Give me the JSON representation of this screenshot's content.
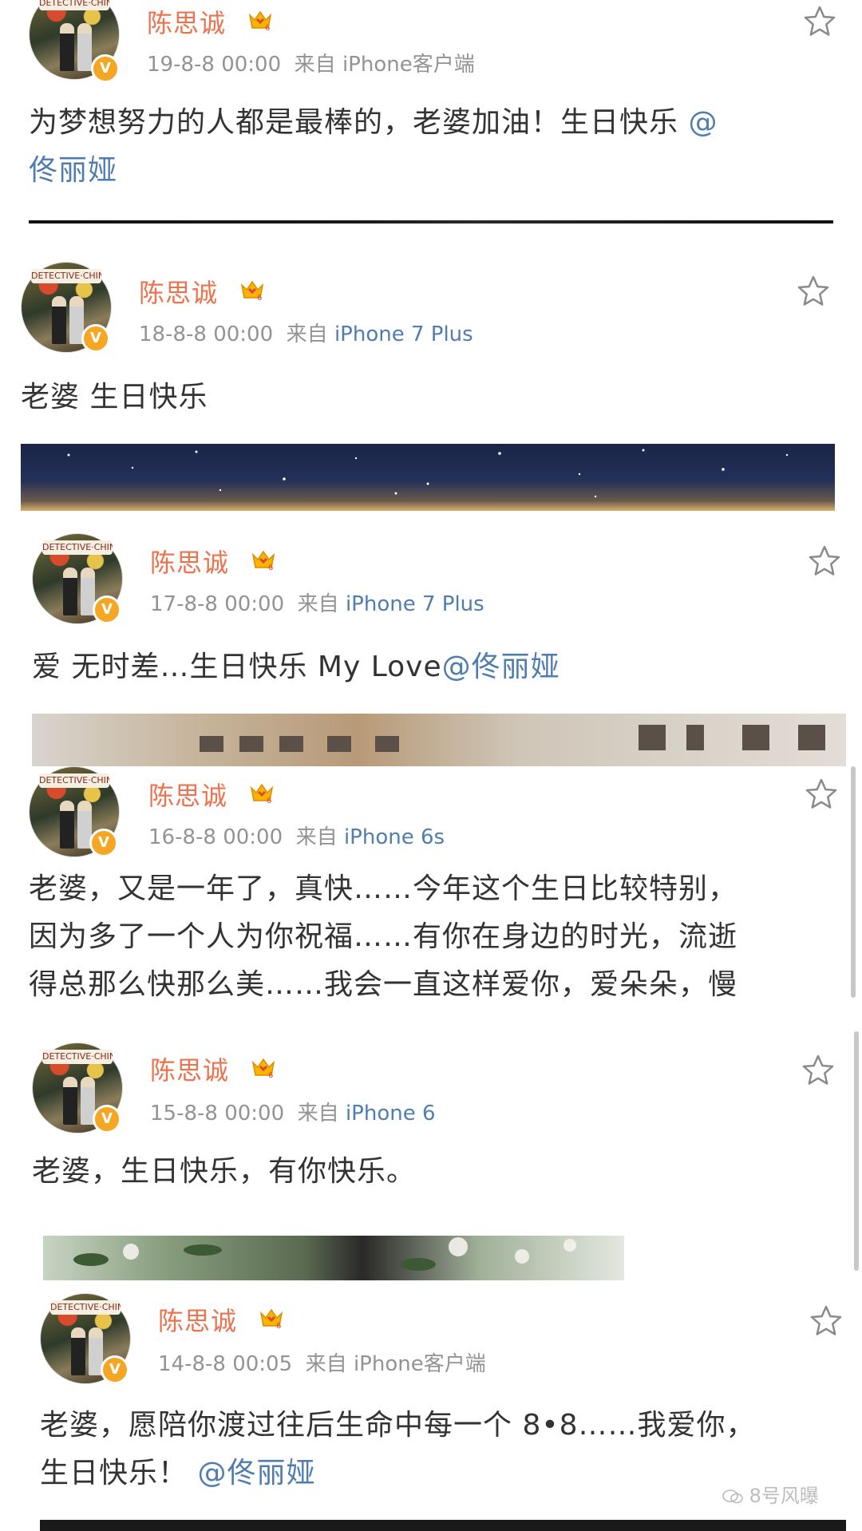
{
  "posts": [
    {
      "user": "陈思诚",
      "time": "19-8-8 00:00",
      "via": "来自",
      "source": "iPhone客户端",
      "source_is_link": false,
      "text": "为梦想努力的人都是最棒的，老婆加油！生日快乐 ",
      "text_mention": "@",
      "text2": "",
      "text2_mention": "佟丽娅"
    },
    {
      "user": "陈思诚",
      "time": "18-8-8 00:00",
      "via": "来自",
      "source": "iPhone 7 Plus",
      "source_is_link": true,
      "text": "老婆 生日快乐"
    },
    {
      "user": "陈思诚",
      "time": "17-8-8 00:00",
      "via": "来自",
      "source": "iPhone 7 Plus",
      "source_is_link": true,
      "text": "爱 无时差…生日快乐 My Love",
      "text_mention": "@佟丽娅"
    },
    {
      "user": "陈思诚",
      "time": "16-8-8 00:00",
      "via": "来自",
      "source": "iPhone 6s",
      "source_is_link": true,
      "lines": [
        "老婆，又是一年了，真快……今年这个生日比较特别，",
        "因为多了一个人为你祝福……有你在身边的时光，流逝",
        "得总那么快那么美……我会一直这样爱你，爱朵朵，慢"
      ]
    },
    {
      "user": "陈思诚",
      "time": "15-8-8 00:00",
      "via": "来自",
      "source": "iPhone 6",
      "source_is_link": true,
      "text": "老婆，生日快乐，有你快乐。"
    },
    {
      "user": "陈思诚",
      "time": "14-8-8 00:05",
      "via": "来自",
      "source": "iPhone客户端",
      "source_is_link": false,
      "text": "老婆，愿陪你渡过往后生命中每一个 8•8……我爱你，",
      "text2": "生日快乐！",
      "text2_mention": "@佟丽娅"
    }
  ],
  "avatar_sign": "DETECTIVE·CHINATOWN",
  "verified_mark": "V",
  "crown_level": "6",
  "watermark": "8号风曝",
  "colors": {
    "name": "#eb7350",
    "meta": "#939393",
    "link": "#507daf",
    "text": "#333333",
    "badge": "#f5a623"
  }
}
